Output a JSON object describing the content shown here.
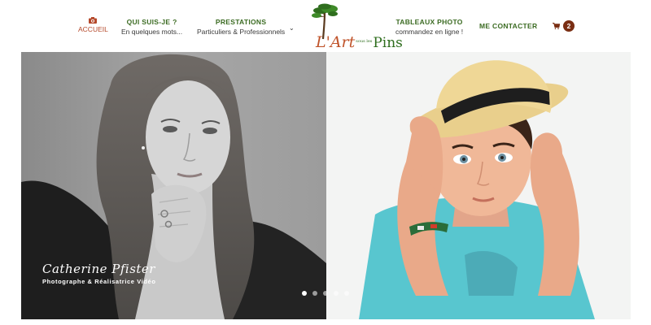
{
  "nav": {
    "home": {
      "label": "ACCUEIL",
      "icon": "camera-icon"
    },
    "about": {
      "title": "QUI SUIS-JE ?",
      "subtitle": "En quelques mots..."
    },
    "services": {
      "title": "PRESTATIONS",
      "subtitle": "Particuliers & Professionnels"
    },
    "photo_tables": {
      "title": "TABLEAUX PHOTO",
      "subtitle": "commandez en ligne !"
    },
    "contact": {
      "title": "ME CONTACTER"
    }
  },
  "logo": {
    "text_l": "L'Art",
    "text_small": "sous les",
    "text_pins": "Pins"
  },
  "cart": {
    "count": "2",
    "icon": "cart-icon"
  },
  "slider": {
    "caption_name": "Catherine Pfister",
    "caption_subtitle": "Photographe & Réalisatrice Vidéo",
    "dots": 5,
    "active_dot": 1
  },
  "colors": {
    "nav_green": "#3b6b22",
    "home_red": "#b5482a",
    "badge": "#7a2e13"
  }
}
